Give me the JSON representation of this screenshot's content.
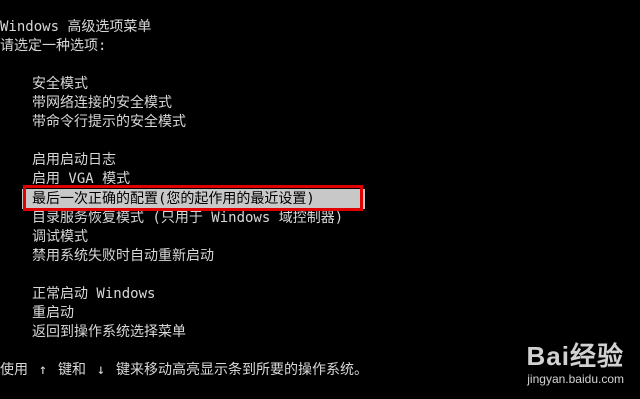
{
  "header": {
    "title": "Windows 高级选项菜单",
    "prompt": "请选定一种选项:"
  },
  "options": [
    "安全模式",
    "带网络连接的安全模式",
    "带命令行提示的安全模式",
    "启用启动日志",
    "启用 VGA 模式",
    "最后一次正确的配置(您的起作用的最近设置)",
    "目录服务恢复模式 (只用于 Windows 域控制器)",
    "调试模式",
    "禁用系统失败时自动重新启动",
    "正常启动 Windows",
    "重启动",
    "返回到操作系统选择菜单"
  ],
  "footer": {
    "use": "使用",
    "arrow_up": "↑",
    "and_keys": "键和",
    "arrow_down": "↓",
    "instruction": "键来移动高亮显示条到所要的操作系统。"
  },
  "watermark": {
    "logo": "Bai经验",
    "site": "jingyan.baidu.com"
  },
  "colors": {
    "background": "#000000",
    "text": "#d8d8d8",
    "highlight_bg": "#c8c8c8",
    "highlight_text": "#000000",
    "annotation_box": "#e00000"
  }
}
